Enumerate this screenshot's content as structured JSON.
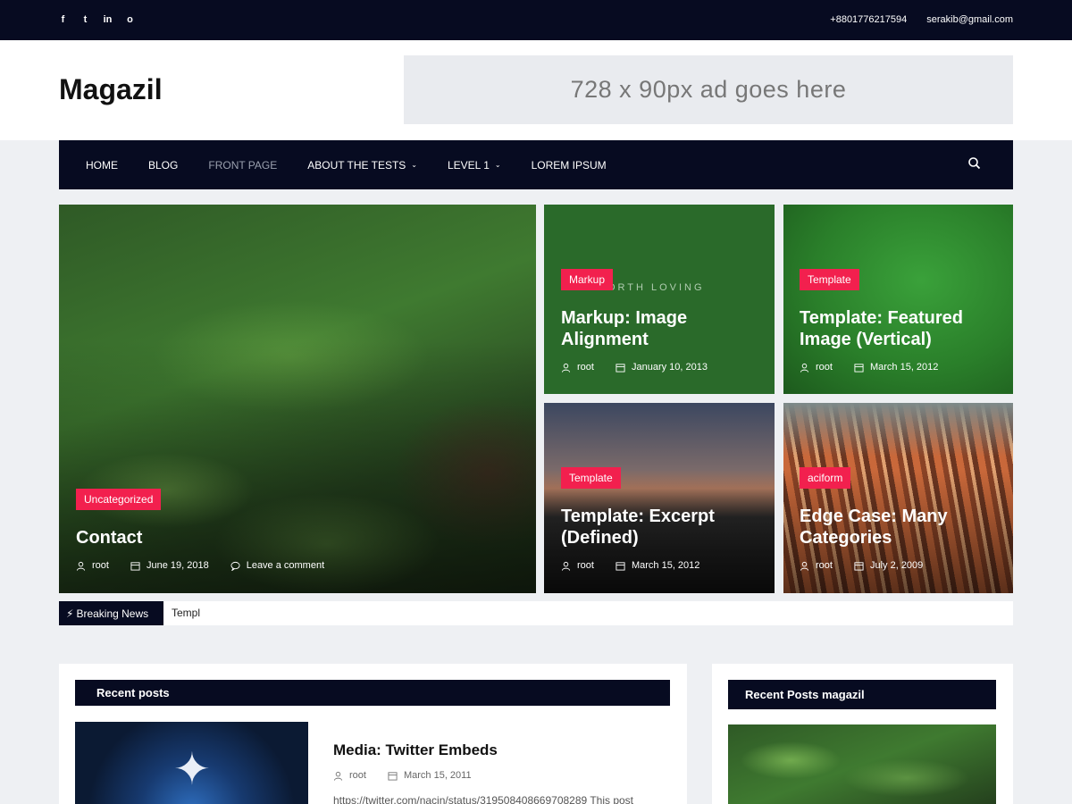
{
  "topbar": {
    "social": [
      {
        "icon": "facebook-icon",
        "glyph": "f"
      },
      {
        "icon": "twitter-icon",
        "glyph": "t"
      },
      {
        "icon": "linkedin-icon",
        "glyph": "in"
      },
      {
        "icon": "github-icon",
        "glyph": "o"
      }
    ],
    "phone": "+8801776217594",
    "email": "serakib@gmail.com"
  },
  "header": {
    "site_title": "Magazil",
    "ad_text": "728 x 90px ad goes here"
  },
  "nav": {
    "items": [
      {
        "label": "HOME"
      },
      {
        "label": "BLOG"
      },
      {
        "label": "FRONT PAGE"
      },
      {
        "label": "ABOUT THE TESTS"
      },
      {
        "label": "LEVEL 1"
      },
      {
        "label": "LOREM IPSUM"
      }
    ]
  },
  "featured": [
    {
      "category": "Uncategorized",
      "title": "Contact",
      "author": "root",
      "date": "June 19, 2018",
      "comments": "Leave a comment"
    },
    {
      "category": "Markup",
      "title_line1": "Markup: Image",
      "title_line2": "Alignment",
      "author": "root",
      "date": "January 10, 2013",
      "watermark": "NORTH LOVING"
    },
    {
      "category": "Template",
      "title_line1": "Template: Featured",
      "title_line2": "Image (Vertical)",
      "author": "root",
      "date": "March 15, 2012"
    },
    {
      "category": "Template",
      "title_line1": "Template: Excerpt",
      "title_line2": "(Defined)",
      "author": "root",
      "date": "March 15, 2012"
    },
    {
      "category": "aciform",
      "title_line1": "Edge Case: Many",
      "title_line2": "Categories",
      "author": "root",
      "date": "July 2, 2009"
    }
  ],
  "breaking": {
    "label": "Breaking News",
    "text": "Templ"
  },
  "recent_posts": {
    "heading": "Recent posts",
    "post": {
      "title": "Media: Twitter Embeds",
      "author": "root",
      "date": "March 15, 2011",
      "excerpt": "https://twitter.com/nacin/status/319508408669708289 This post"
    }
  },
  "sidebar": {
    "heading": "Recent Posts magazil"
  },
  "colors": {
    "dark": "#070b21",
    "accent": "#f2204e"
  }
}
